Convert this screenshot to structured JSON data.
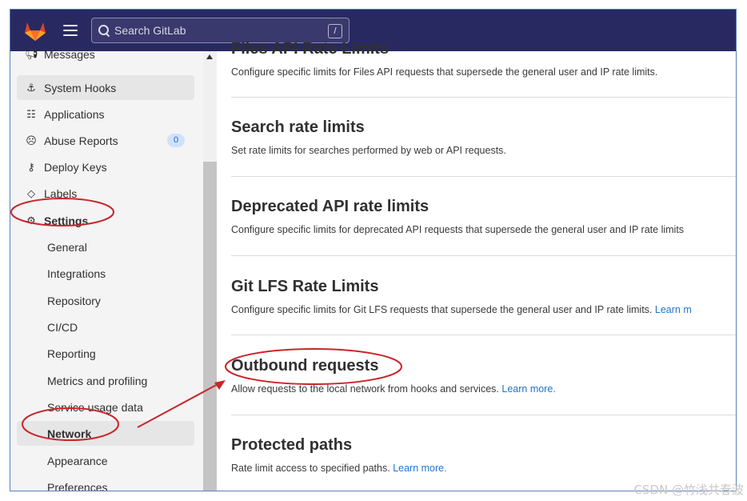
{
  "navbar": {
    "search_placeholder": "Search GitLab",
    "search_shortcut": "/",
    "bg_color": "#292961"
  },
  "sidebar": {
    "items": [
      {
        "label": "Messages",
        "icon": "bullhorn-icon"
      },
      {
        "label": "System Hooks",
        "icon": "hook-icon"
      },
      {
        "label": "Applications",
        "icon": "applications-icon"
      },
      {
        "label": "Abuse Reports",
        "icon": "abuse-face-icon",
        "badge": "0"
      },
      {
        "label": "Deploy Keys",
        "icon": "key-icon"
      },
      {
        "label": "Labels",
        "icon": "label-tag-icon"
      },
      {
        "label": "Settings",
        "icon": "settings-gear-icon"
      }
    ],
    "settings_children": [
      "General",
      "Integrations",
      "Repository",
      "CI/CD",
      "Reporting",
      "Metrics and profiling",
      "Service usage data",
      "Network",
      "Appearance",
      "Preferences"
    ],
    "active_item": "Network"
  },
  "main": {
    "sections": [
      {
        "title": "Files API Rate Limits",
        "desc": "Configure specific limits for Files API requests that supersede the general user and IP rate limits.",
        "link": ""
      },
      {
        "title": "Search rate limits",
        "desc": "Set rate limits for searches performed by web or API requests.",
        "link": ""
      },
      {
        "title": "Deprecated API rate limits",
        "desc": "Configure specific limits for deprecated API requests that supersede the general user and IP rate limits",
        "link": ""
      },
      {
        "title": "Git LFS Rate Limits",
        "desc": "Configure specific limits for Git LFS requests that supersede the general user and IP rate limits.",
        "link": "Learn m"
      },
      {
        "title": "Outbound requests",
        "desc": "Allow requests to the local network from hooks and services.",
        "link": "Learn more."
      },
      {
        "title": "Protected paths",
        "desc": "Rate limit access to specified paths.",
        "link": "Learn more."
      }
    ]
  },
  "watermark": "CSDN @竹浅共春波",
  "colors": {
    "accent_link": "#1f75cb",
    "annotation_red": "#c8262b"
  }
}
